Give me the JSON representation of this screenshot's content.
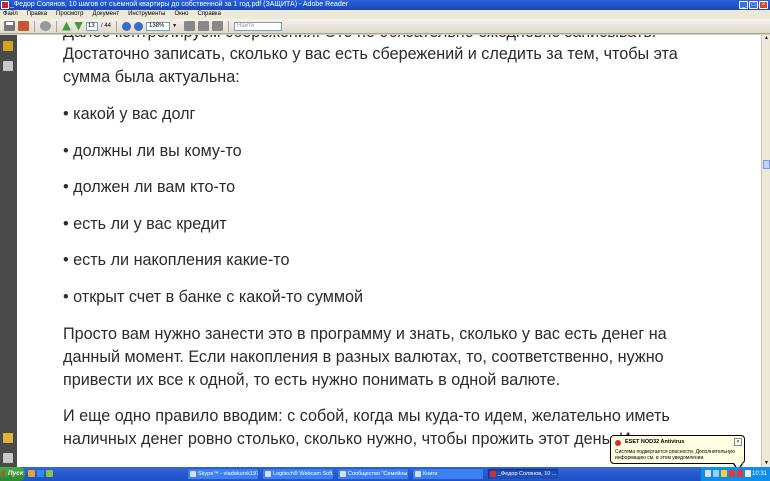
{
  "window": {
    "title": "_Федор Солянов, 10 шагов от съемной квартиры до собственной за 1 год.pdf (ЗАЩИТА) - Adobe Reader"
  },
  "menu": [
    "Файл",
    "Правка",
    "Просмотр",
    "Документ",
    "Инструменты",
    "Окно",
    "Справка"
  ],
  "toolbar": {
    "page_current": "13",
    "page_total": "/ 44",
    "zoom": "138%",
    "search_placeholder": "Найти"
  },
  "document": {
    "lines": [
      "Далее контролируем сбережения. Это не обязательно ежедневно записывать.",
      "Достаточно записать, сколько у вас есть сбережений и следить за тем,  чтобы эта",
      "сумма была актуальна:",
      "• какой у вас  долг",
      "• должны ли вы кому-то",
      "• должен ли вам  кто-то",
      "• есть ли у вас кредит",
      "• есть ли накопления какие-то",
      "• открыт счет в банке с какой-то суммой",
      "Просто вам нужно занести это в программу и знать,  сколько у вас есть денег на",
      "данный момент. Если накопления в разных валютах, то, соответственно, нужно",
      "привести их все к одной, то есть нужно понимать в одной валюте.",
      "И еще одно правило вводим: с собой,  когда  мы куда-то идем, желательно  иметь",
      "наличных денег ровно столько,  сколько нужно, чтобы прожить этот день. И"
    ]
  },
  "taskbar": {
    "start_label": "Пуск",
    "tasks": [
      "Skype™ - vladakursk1974",
      "Logitech® Webcam Soft...",
      "Сообщество \"Семейны...",
      "Книги",
      "_Федор Солянов, 10 ..."
    ],
    "clock": "10:31"
  },
  "notification": {
    "title": "ESET NOD32 Antivirus",
    "body": "Система подвергается опасности. Дополнительную информацию см. в этом уведомлении."
  }
}
